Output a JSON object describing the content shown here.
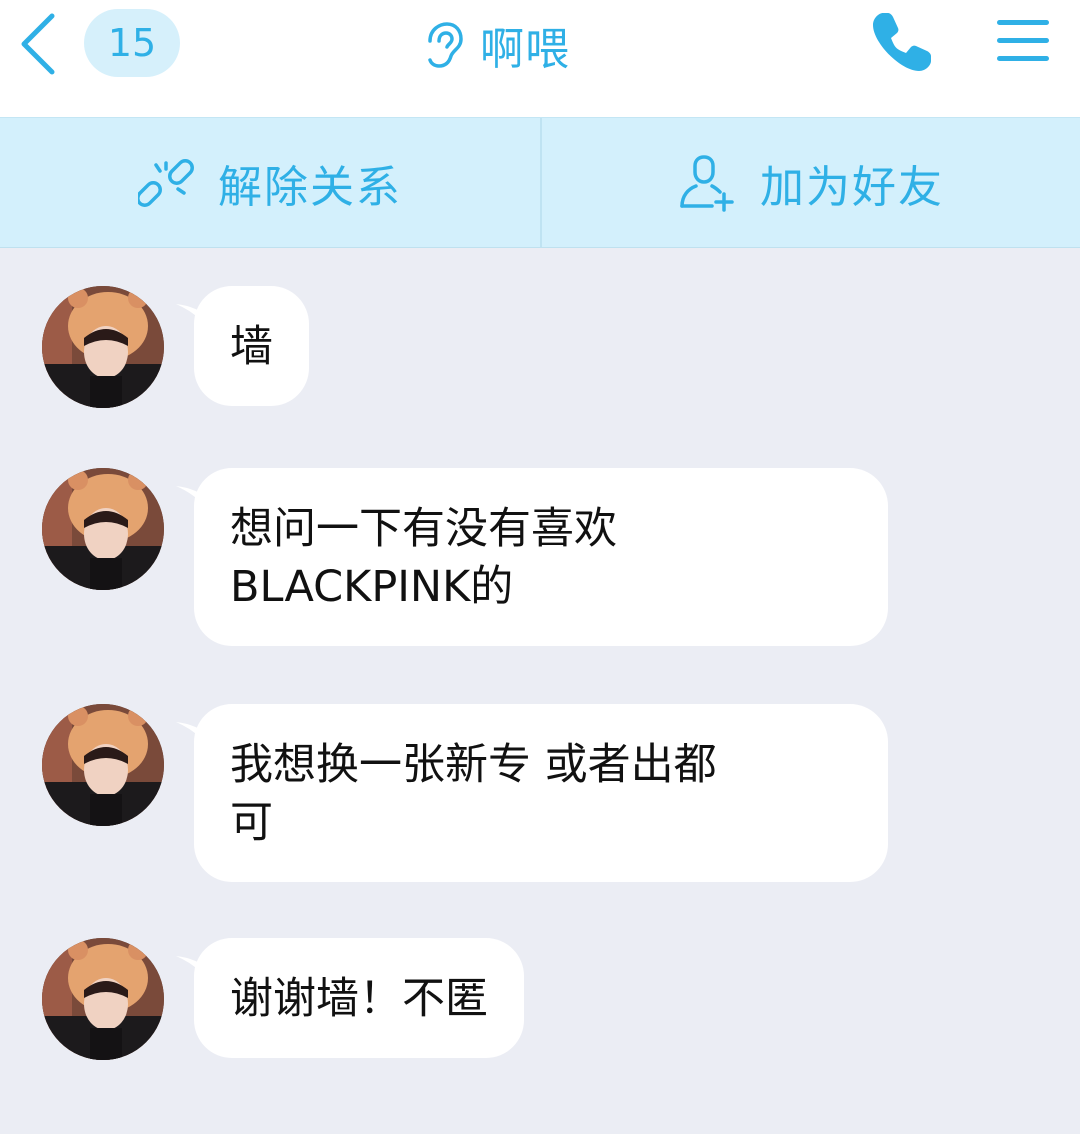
{
  "header": {
    "unread_count": "15",
    "title": "啊喂",
    "icons": {
      "back": "chevron-left-icon",
      "ear": "ear-icon",
      "call": "phone-icon",
      "menu": "menu-icon"
    }
  },
  "actions": [
    {
      "label": "解除关系",
      "icon": "unlink-icon"
    },
    {
      "label": "加为好友",
      "icon": "add-friend-icon"
    }
  ],
  "messages": [
    {
      "lines": [
        "墙"
      ]
    },
    {
      "lines": [
        "想问一下有没有喜欢",
        "BLACKPINK的"
      ]
    },
    {
      "lines": [
        "我想换一张新专 或者出都",
        "可"
      ]
    },
    {
      "lines": [
        "谢谢墙！不匿"
      ]
    }
  ],
  "colors": {
    "accent": "#2fb0e6",
    "action_bar_bg": "#d3f0fc",
    "chat_bg": "#ebedf4",
    "bubble_bg": "#ffffff",
    "badge_bg": "#d6f0fb"
  }
}
